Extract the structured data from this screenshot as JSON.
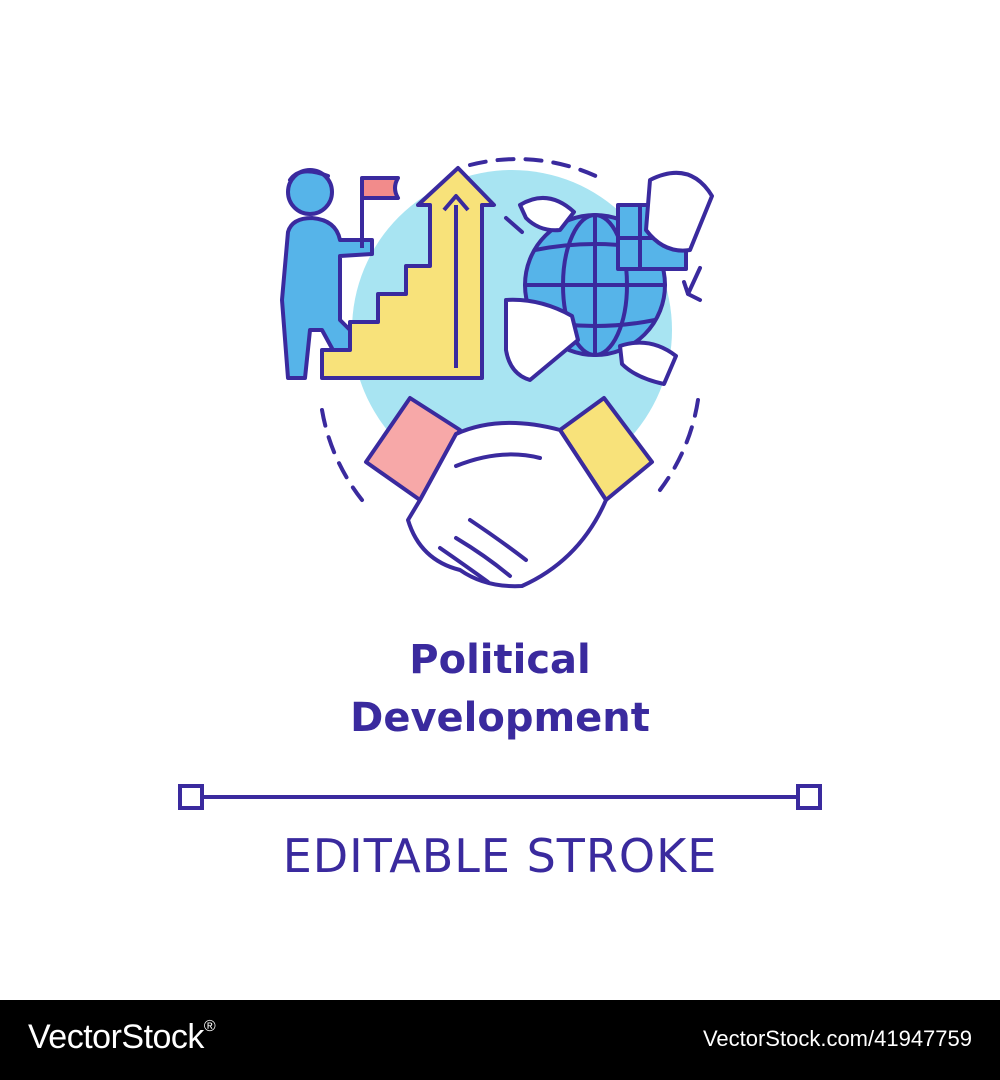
{
  "title": {
    "line1": "Political",
    "line2": "Development"
  },
  "subtitle": "EDITABLE STROKE",
  "footer": {
    "brand": "VectorStock",
    "reg_mark": "®",
    "url": "VectorStock.com/41947759"
  },
  "colors": {
    "outline": "#3a2a9e",
    "person_blue": "#56b4e9",
    "bg_circle": "#a8e4f2",
    "yellow": "#f8e27a",
    "pink": "#f7a8a8",
    "flag": "#f28b8b",
    "globe_blue": "#56b4e9",
    "background": "#ffffff",
    "footer_bg": "#000000"
  },
  "icons": [
    "person-climbing-icon",
    "flag-icon",
    "staircase-arrow-icon",
    "globe-puzzle-icon",
    "handshake-icon"
  ]
}
